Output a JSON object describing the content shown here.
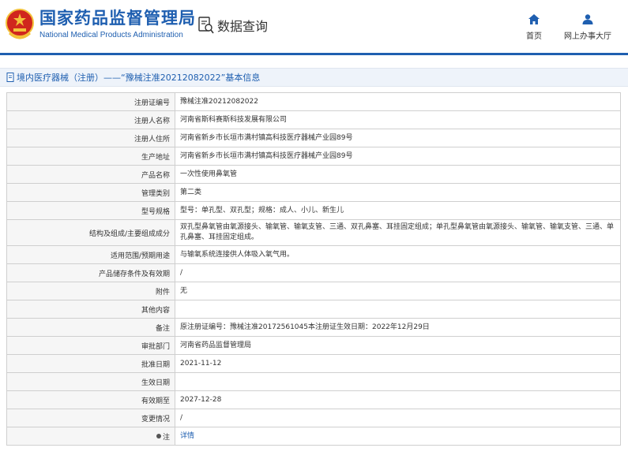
{
  "header": {
    "org_cn": "国家药品监督管理局",
    "org_en": "National Medical Products Administration",
    "query_label": "数据查询",
    "nav": [
      {
        "label": "首页",
        "icon": "home-icon"
      },
      {
        "label": "网上办事大厅",
        "icon": "user-icon"
      }
    ]
  },
  "title": "境内医疗器械（注册）——“豫械注准20212082022”基本信息",
  "rows": [
    {
      "label": "注册证编号",
      "value": "豫械注准20212082022"
    },
    {
      "label": "注册人名称",
      "value": "河南省斯科赛斯科技发展有限公司"
    },
    {
      "label": "注册人住所",
      "value": "河南省新乡市长垣市满村镇高科技医疗器械产业园89号"
    },
    {
      "label": "生产地址",
      "value": "河南省新乡市长垣市满村镇高科技医疗器械产业园89号"
    },
    {
      "label": "产品名称",
      "value": "一次性使用鼻氧管"
    },
    {
      "label": "管理类别",
      "value": "第二类"
    },
    {
      "label": "型号规格",
      "value": "型号：单孔型、双孔型；规格：成人、小儿、新生儿"
    },
    {
      "label": "结构及组成/主要组成成分",
      "value": "双孔型鼻氧管由氧源接头、输氧管、输氧支管、三通、双孔鼻塞、耳挂固定组成；单孔型鼻氧管由氧源接头、输氧管、输氧支管、三通、单孔鼻塞、耳挂固定组成。"
    },
    {
      "label": "适用范围/预期用途",
      "value": "与输氧系统连接供人体吸入氧气用。"
    },
    {
      "label": "产品储存条件及有效期",
      "value": "/"
    },
    {
      "label": "附件",
      "value": "无"
    },
    {
      "label": "其他内容",
      "value": ""
    },
    {
      "label": "备注",
      "value": "原注册证编号：豫械注准20172561045本注册证生效日期：2022年12月29日"
    },
    {
      "label": "审批部门",
      "value": "河南省药品监督管理局"
    },
    {
      "label": "批准日期",
      "value": "2021-11-12"
    },
    {
      "label": "生效日期",
      "value": ""
    },
    {
      "label": "有效期至",
      "value": "2027-12-28"
    },
    {
      "label": "变更情况",
      "value": "/"
    }
  ],
  "note_row": {
    "label": "注",
    "link": "详情"
  },
  "colors": {
    "brand": "#1f5fb0",
    "emblem_red": "#d0261d",
    "emblem_gold": "#f3c13a"
  }
}
